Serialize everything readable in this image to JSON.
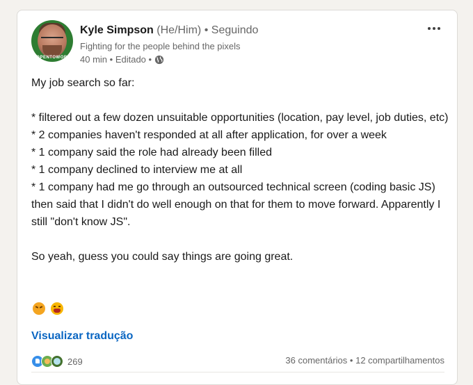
{
  "post": {
    "author": {
      "name": "Kyle Simpson",
      "pronouns": "(He/Him)",
      "follow_status": "• Seguindo",
      "tagline": "Fighting for the people behind the pixels",
      "avatar_ring_text": "#OPENTOWORK"
    },
    "meta": {
      "time": "40 min",
      "edited": "• Editado •",
      "visibility_icon": "globe-icon"
    },
    "body": {
      "intro": "My job search so far:",
      "items": [
        "* filtered out a few dozen unsuitable opportunities (location, pay level, job duties, etc)",
        "* 2 companies haven't responded at all after application, for over a week",
        "* 1 company said the role had already been filled",
        "* 1 company declined to interview me at all",
        "* 1 company had me go through an outsourced technical screen (coding basic JS) then said that I didn't do well enough on that for them to move forward. Apparently I still \"don't know JS\"."
      ],
      "closing": "So yeah, guess you could say things are going great."
    },
    "emojis": [
      "persevering-face-icon",
      "tired-face-icon"
    ],
    "translate_label": "Visualizar tradução",
    "social": {
      "reaction_icons": [
        "like-icon",
        "insightful-icon",
        "funny-icon"
      ],
      "reaction_count": "269",
      "comments": "36 comentários",
      "separator": "•",
      "shares": "12 compartilhamentos"
    },
    "colors": {
      "link_blue": "#0a66c2",
      "open_to_work_green": "#2e7d32",
      "text_primary": "#191919",
      "text_secondary": "#666666"
    }
  }
}
